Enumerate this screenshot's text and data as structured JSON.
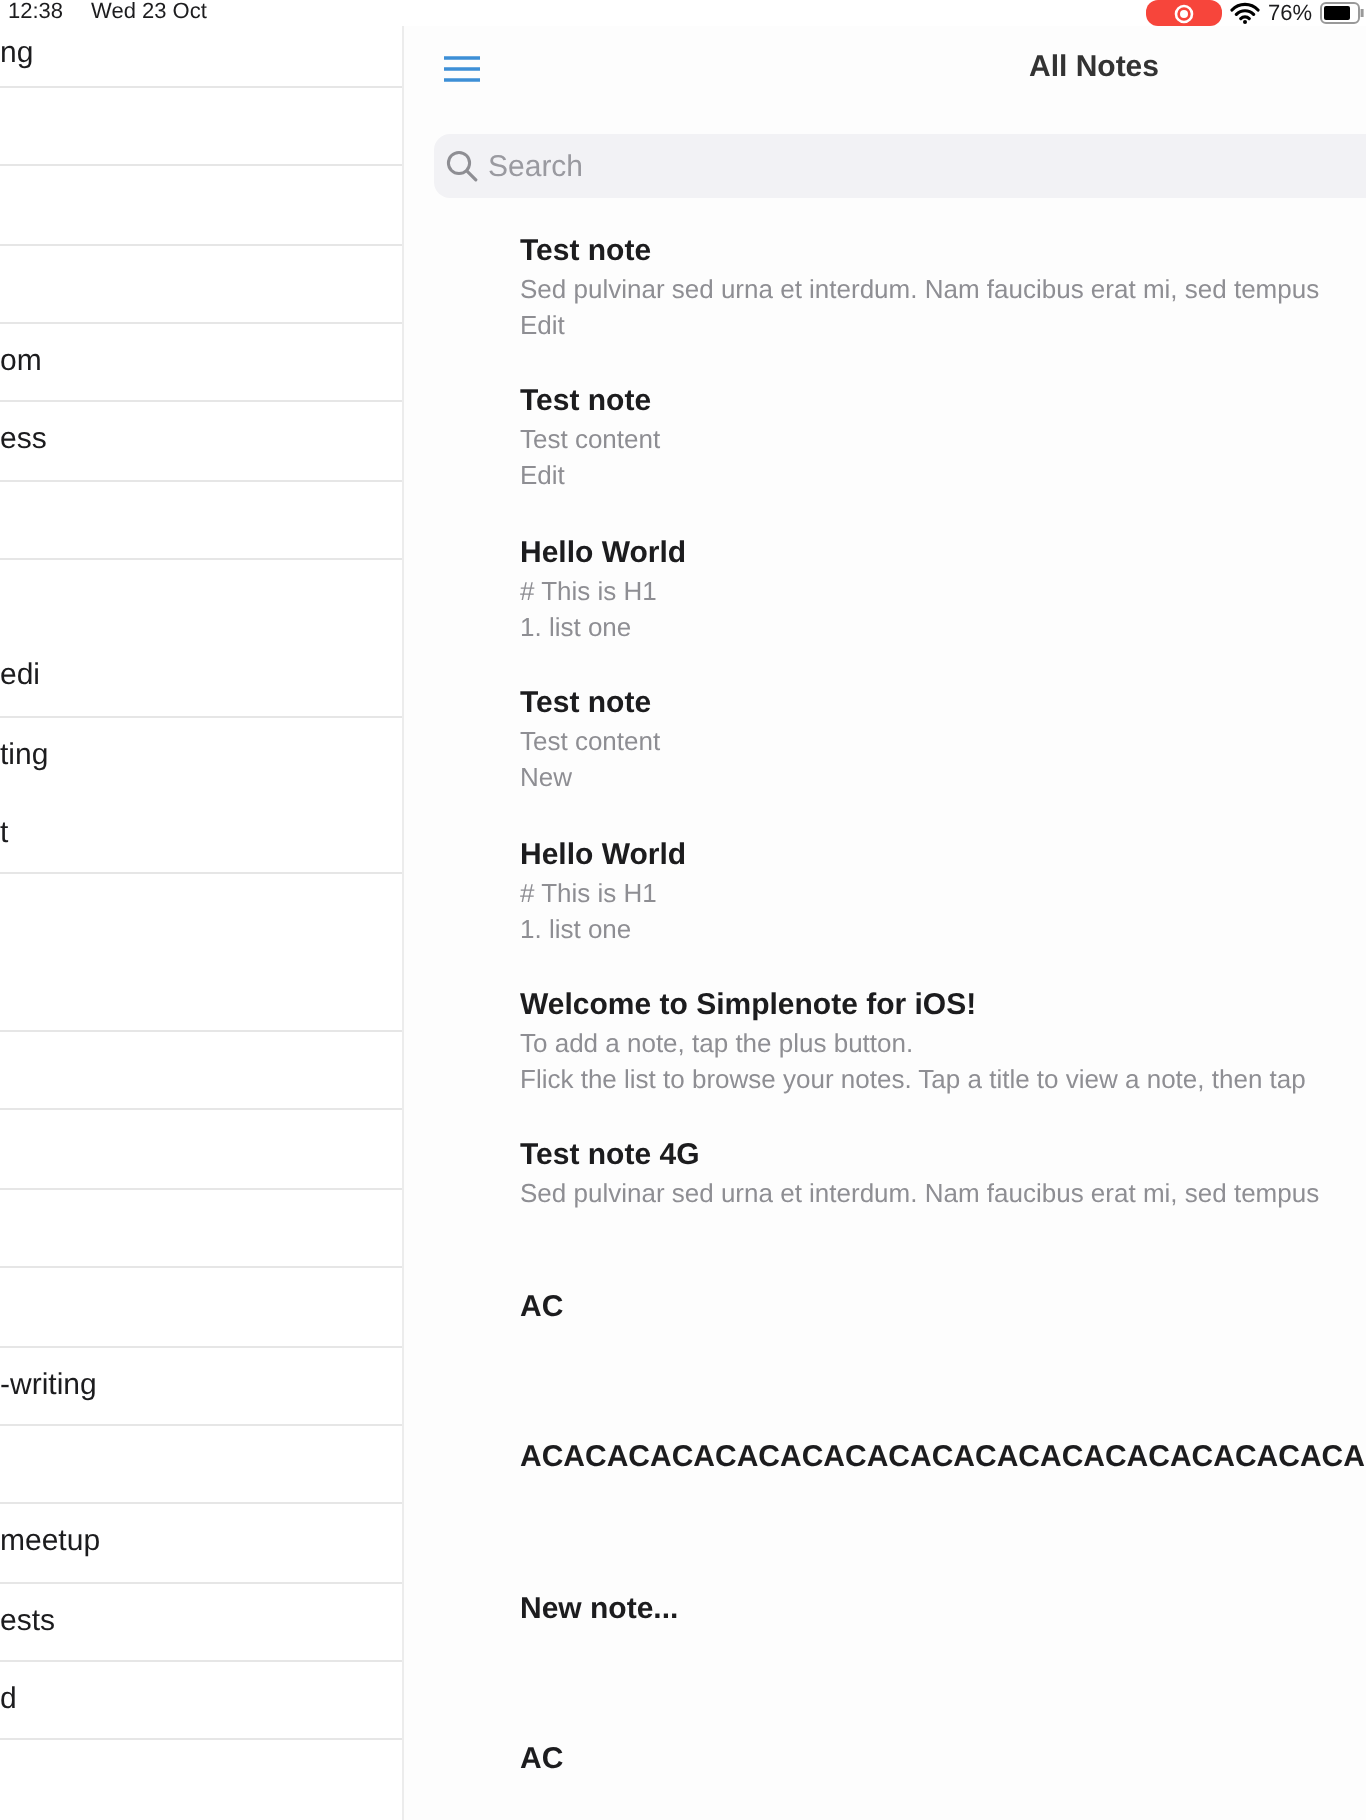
{
  "status_bar": {
    "time": "12:38",
    "date": "Wed 23 Oct",
    "recording": true,
    "battery_text": "76%"
  },
  "sidebar": {
    "items": [
      {
        "lines": [
          "ng"
        ],
        "tall": false
      },
      {
        "tall": false
      },
      {
        "tall": false
      },
      {
        "tall": false
      },
      {
        "lines": [
          "om"
        ],
        "tall": false
      },
      {
        "lines": [
          "ess"
        ],
        "tall": false
      },
      {
        "tall": false
      },
      {
        "lines": [
          "edi"
        ],
        "tall": true
      },
      {
        "lines": [
          "ting",
          "t"
        ],
        "tall": true
      },
      {
        "tall": true
      },
      {
        "tall": false
      },
      {
        "tall": false
      },
      {
        "tall": false
      },
      {
        "tall": false
      },
      {
        "lines": [
          "-writing"
        ],
        "tall": false
      },
      {
        "tall": false
      },
      {
        "lines": [
          "meetup"
        ],
        "tall": false
      },
      {
        "lines": [
          "ests"
        ],
        "tall": false
      },
      {
        "lines": [
          "d"
        ],
        "tall": false
      }
    ]
  },
  "header": {
    "title": "All Notes"
  },
  "search": {
    "placeholder": "Search"
  },
  "notes": [
    {
      "title": "Test note",
      "lines": [
        "Sed pulvinar sed urna et interdum. Nam faucibus erat mi, sed tempus",
        "Edit"
      ]
    },
    {
      "title": "Test note",
      "lines": [
        "Test content",
        "Edit"
      ]
    },
    {
      "title": "Hello World",
      "lines": [
        "# This is H1",
        "1. list one"
      ]
    },
    {
      "title": "Test note",
      "lines": [
        "Test content",
        "New"
      ]
    },
    {
      "title": "Hello World",
      "lines": [
        "# This is H1",
        "1. list one"
      ]
    },
    {
      "title": "Welcome to Simplenote for iOS!",
      "lines": [
        "To add a note, tap the plus button.",
        "Flick the list to browse your notes. Tap a title to view a note, then tap"
      ]
    },
    {
      "title": "Test note 4G",
      "lines": [
        "Sed pulvinar sed urna et interdum. Nam faucibus erat mi, sed tempus"
      ]
    },
    {
      "title": "AC"
    },
    {
      "title": "ACACACACACACACACACACACACACACACACACACACA"
    },
    {
      "title": "New note..."
    },
    {
      "title": "AC"
    }
  ]
}
